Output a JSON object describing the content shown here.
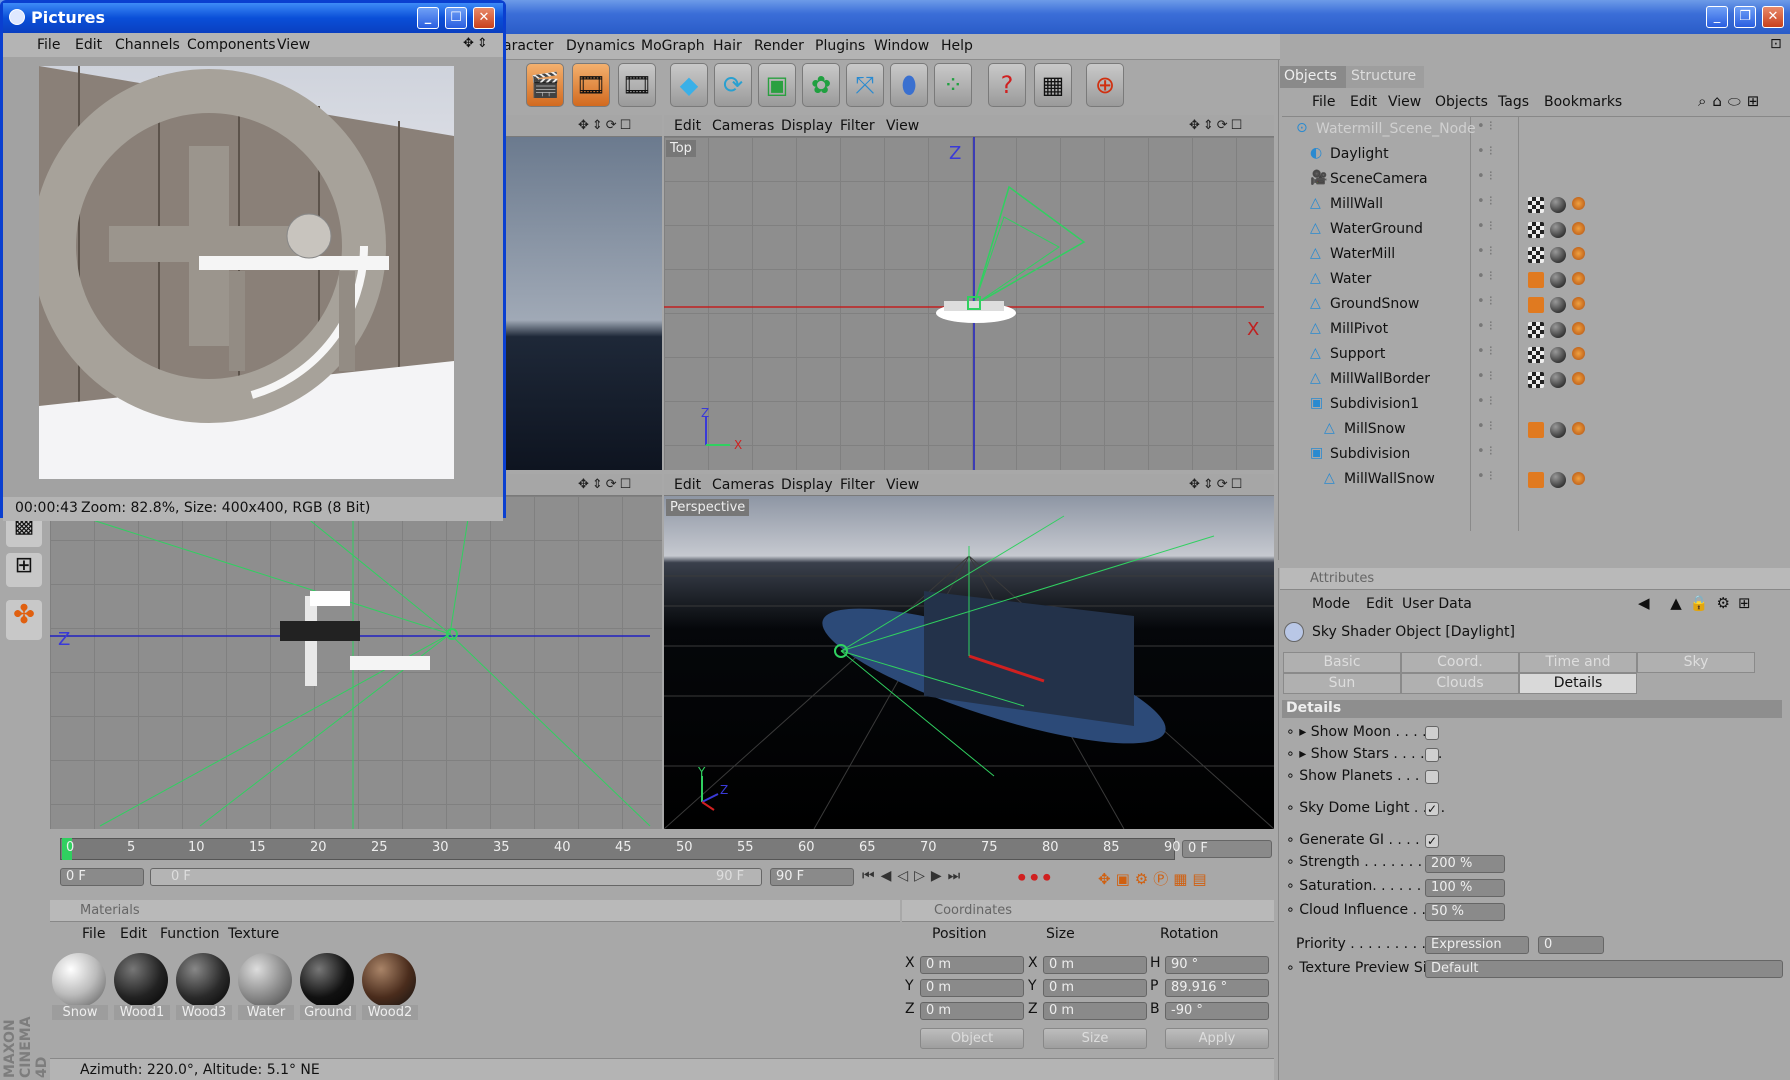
{
  "colors": {
    "titlebar": "#2a5cc8",
    "panel": "#a8a8a8",
    "grid": "#8e8e8e",
    "accent_green": "#30d060",
    "axis_red": "#d02020",
    "axis_blue": "#2020c0"
  },
  "menubar": {
    "items": [
      "aracter",
      "Dynamics",
      "MoGraph",
      "Hair",
      "Render",
      "Plugins",
      "Window",
      "Help"
    ]
  },
  "pictures_window": {
    "title": "Pictures",
    "menu": [
      "File",
      "Edit",
      "Channels",
      "Components",
      "View"
    ],
    "status": "00:00:43",
    "status_info": "Zoom: 82.8%, Size: 400x400, RGB (8 Bit)"
  },
  "viewports": {
    "menu": [
      "Edit",
      "Cameras",
      "Display",
      "Filter",
      "View"
    ],
    "top_label": "Top",
    "perspective_label": "Perspective",
    "axis_x": "X",
    "axis_z": "Z",
    "axis_y": "Y"
  },
  "objects_panel": {
    "tabs": [
      "Objects",
      "Structure"
    ],
    "menu": [
      "File",
      "Edit",
      "View",
      "Objects",
      "Tags",
      "Bookmarks"
    ],
    "items": [
      {
        "name": "Watermill_Scene_Node",
        "indent": 0,
        "icon": "null-object-icon",
        "dim": true
      },
      {
        "name": "Daylight",
        "indent": 1,
        "icon": "sky-icon"
      },
      {
        "name": "SceneCamera",
        "indent": 1,
        "icon": "camera-icon"
      },
      {
        "name": "MillWall",
        "indent": 1,
        "icon": "polygon-icon"
      },
      {
        "name": "WaterGround",
        "indent": 1,
        "icon": "polygon-icon"
      },
      {
        "name": "WaterMill",
        "indent": 1,
        "icon": "polygon-icon"
      },
      {
        "name": "Water",
        "indent": 1,
        "icon": "polygon-icon"
      },
      {
        "name": "GroundSnow",
        "indent": 1,
        "icon": "polygon-icon"
      },
      {
        "name": "MillPivot",
        "indent": 1,
        "icon": "polygon-icon"
      },
      {
        "name": "Support",
        "indent": 1,
        "icon": "polygon-icon"
      },
      {
        "name": "MillWallBorder",
        "indent": 1,
        "icon": "polygon-icon"
      },
      {
        "name": "Subdivision1",
        "indent": 1,
        "icon": "subdivision-icon"
      },
      {
        "name": "MillSnow",
        "indent": 2,
        "icon": "polygon-icon"
      },
      {
        "name": "Subdivision",
        "indent": 1,
        "icon": "subdivision-icon"
      },
      {
        "name": "MillWallSnow",
        "indent": 2,
        "icon": "polygon-icon"
      }
    ]
  },
  "attributes_panel": {
    "header": "Attributes",
    "menu": [
      "Mode",
      "Edit",
      "User Data"
    ],
    "object_title": "Sky Shader Object [Daylight]",
    "tabs_row1": [
      "Basic",
      "Coord.",
      "Time and Location",
      "Sky"
    ],
    "tabs_row2": [
      "Sun",
      "Clouds",
      "Details"
    ],
    "section": "Details",
    "rows": {
      "show_moon": "Show Moon . . . . .",
      "show_stars": "Show Stars . . . . . .",
      "show_planets": "Show Planets . . . . .",
      "sky_dome_light": "Sky Dome Light . . . .",
      "generate_gi": "Generate GI . . . . . .",
      "strength": "Strength . . . . . . . . .",
      "strength_val": "200 %",
      "saturation": "Saturation. . . . . . . .",
      "saturation_val": "100 %",
      "cloud_influence": "Cloud Influence . . . .",
      "cloud_influence_val": "50 %",
      "priority": "Priority . . . . . . . . . . .",
      "priority_val": "Expression",
      "priority_num": "0",
      "texture_preview": "Texture Preview Size",
      "texture_preview_val": "Default"
    }
  },
  "timeline": {
    "ticks": [
      "0",
      "5",
      "10",
      "15",
      "20",
      "25",
      "30",
      "35",
      "40",
      "45",
      "50",
      "55",
      "60",
      "65",
      "70",
      "75",
      "80",
      "85",
      "90"
    ],
    "current_frame": "0 F",
    "start": "0 F",
    "range_start": "0 F",
    "range_end": "90 F",
    "end": "90 F"
  },
  "materials_panel": {
    "header": "Materials",
    "menu": [
      "File",
      "Edit",
      "Function",
      "Texture"
    ],
    "items": [
      "Snow",
      "Wood1",
      "Wood3",
      "Water",
      "Ground",
      "Wood2"
    ]
  },
  "coordinates_panel": {
    "header": "Coordinates",
    "cols": [
      "Position",
      "Size",
      "Rotation"
    ],
    "pos": {
      "x": "0 m",
      "y": "0 m",
      "z": "0 m"
    },
    "size": {
      "x": "0 m",
      "y": "0 m",
      "z": "0 m"
    },
    "rot": {
      "h": "90 °",
      "p": "89.916 °",
      "b": "-90 °"
    },
    "mode1": "Object",
    "mode2": "Size",
    "apply": "Apply",
    "labels": {
      "x": "X",
      "y": "Y",
      "z": "Z",
      "h": "H",
      "p": "P",
      "b": "B"
    }
  },
  "statusbar": {
    "text": "Azimuth: 220.0°, Altitude: 5.1°  NE"
  },
  "branding": {
    "maxon": "MAXON",
    "cinema": "CINEMA 4D"
  }
}
